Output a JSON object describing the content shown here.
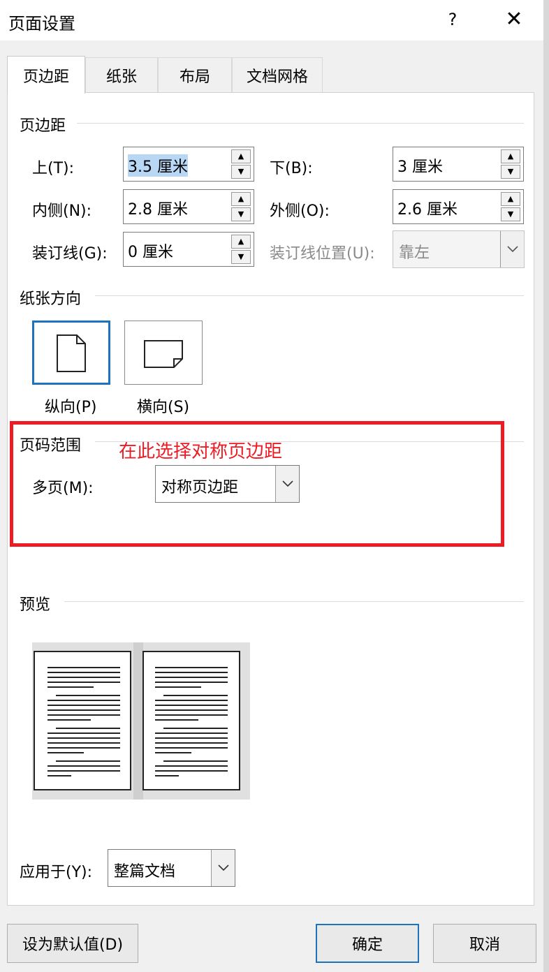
{
  "dialog": {
    "title": "页面设置",
    "help_label": "?",
    "close_label": "✕"
  },
  "tabs": [
    "页边距",
    "纸张",
    "布局",
    "文档网格"
  ],
  "margins": {
    "section_label": "页边距",
    "top": {
      "label": "上(T):",
      "value": "3.5 厘米"
    },
    "bottom": {
      "label": "下(B):",
      "value": "3 厘米"
    },
    "inside": {
      "label": "内侧(N):",
      "value": "2.8 厘米"
    },
    "outside": {
      "label": "外侧(O):",
      "value": "2.6 厘米"
    },
    "gutter": {
      "label": "装订线(G):",
      "value": "0 厘米"
    },
    "gutter_position": {
      "label": "装订线位置(U):",
      "value": "靠左"
    }
  },
  "orientation": {
    "section_label": "纸张方向",
    "portrait_label": "纵向(P)",
    "landscape_label": "横向(S)",
    "selected": "portrait"
  },
  "pages": {
    "section_label": "页码范围",
    "multiple_label": "多页(M):",
    "multiple_value": "对称页边距"
  },
  "annotation": {
    "text": "在此选择对称页边距",
    "color": "#ed1c24"
  },
  "preview": {
    "section_label": "预览"
  },
  "apply_to": {
    "label": "应用于(Y):",
    "value": "整篇文档"
  },
  "buttons": {
    "set_default": "设为默认值(D)",
    "ok": "确定",
    "cancel": "取消"
  },
  "colors": {
    "accent": "#1e73be",
    "highlight": "#b8d7f5"
  }
}
